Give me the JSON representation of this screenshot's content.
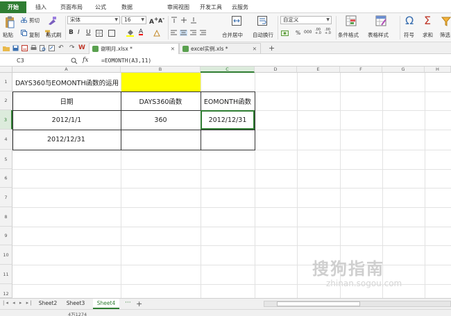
{
  "ribbon_tabs": [
    "开始",
    "插入",
    "页面布局",
    "公式",
    "数据",
    "审阅",
    "视图",
    "开发工具",
    "云服务"
  ],
  "ribbon": {
    "paste": "粘贴",
    "cut": "剪切",
    "copy": "复制",
    "format_painter": "格式刷",
    "font_name": "宋体",
    "font_size": "16",
    "merge_center": "合并居中",
    "wrap_text": "自动换行",
    "number_format": "自定义",
    "conditional_format": "条件格式",
    "table_style": "表格样式",
    "symbol": "符号",
    "sum": "求和",
    "filter": "筛选",
    "percent": "%",
    "thousands": "000",
    "decimals_inc": ".00 +.0",
    "decimals_dec": ".00 +.0"
  },
  "documents": [
    {
      "name": "谢明月.xlsx *",
      "active": true
    },
    {
      "name": "excel实例.xls *",
      "active": false
    }
  ],
  "formula_bar": {
    "name_box": "C3",
    "fx": "fx",
    "formula": "=EOMONTH(A3,11)"
  },
  "columns": [
    "A",
    "B",
    "C",
    "D",
    "E",
    "F",
    "G",
    "H"
  ],
  "selected_column": "C",
  "rows": [
    "1",
    "2",
    "3",
    "4",
    "5",
    "6",
    "7",
    "8",
    "9",
    "10",
    "11",
    "12"
  ],
  "selected_row": "3",
  "cells": {
    "A1": "DAYS360与EOMONTH函数的运用",
    "A2": "日期",
    "B2": "DAYS360函数",
    "C2": "EOMONTH函数",
    "A3": "2012/1/1",
    "B3": "360",
    "C3": "2012/12/31",
    "A4": "2012/12/31"
  },
  "fill_colors": {
    "B1": "#ffff00",
    "accent": "#2f7d32"
  },
  "sheets": [
    "Sheet2",
    "Sheet3",
    "Sheet4"
  ],
  "active_sheet": "Sheet4",
  "status": {
    "text": "4万1274"
  },
  "watermark": {
    "line1": "搜狗指南",
    "line2": "zhinan.sogou.com"
  },
  "icons": [
    "paste-icon",
    "cut-icon",
    "copy-icon",
    "format-painter-icon",
    "bold-icon",
    "italic-icon",
    "underline-icon",
    "borders-icon",
    "fill-color-icon",
    "font-color-icon",
    "clear-icon",
    "align-top-icon",
    "align-middle-icon",
    "align-bottom-icon",
    "align-left-icon",
    "align-center-icon",
    "align-right-icon",
    "merge-center-icon",
    "wrap-text-icon",
    "currency-icon",
    "percent-icon",
    "conditional-format-icon",
    "table-style-icon",
    "symbol-icon",
    "sum-icon",
    "filter-icon",
    "open-icon",
    "save-icon",
    "print-icon",
    "preview-icon",
    "undo-icon",
    "redo-icon",
    "zoom-icon",
    "fx-icon",
    "add-sheet-icon",
    "sheet-nav-icon"
  ]
}
